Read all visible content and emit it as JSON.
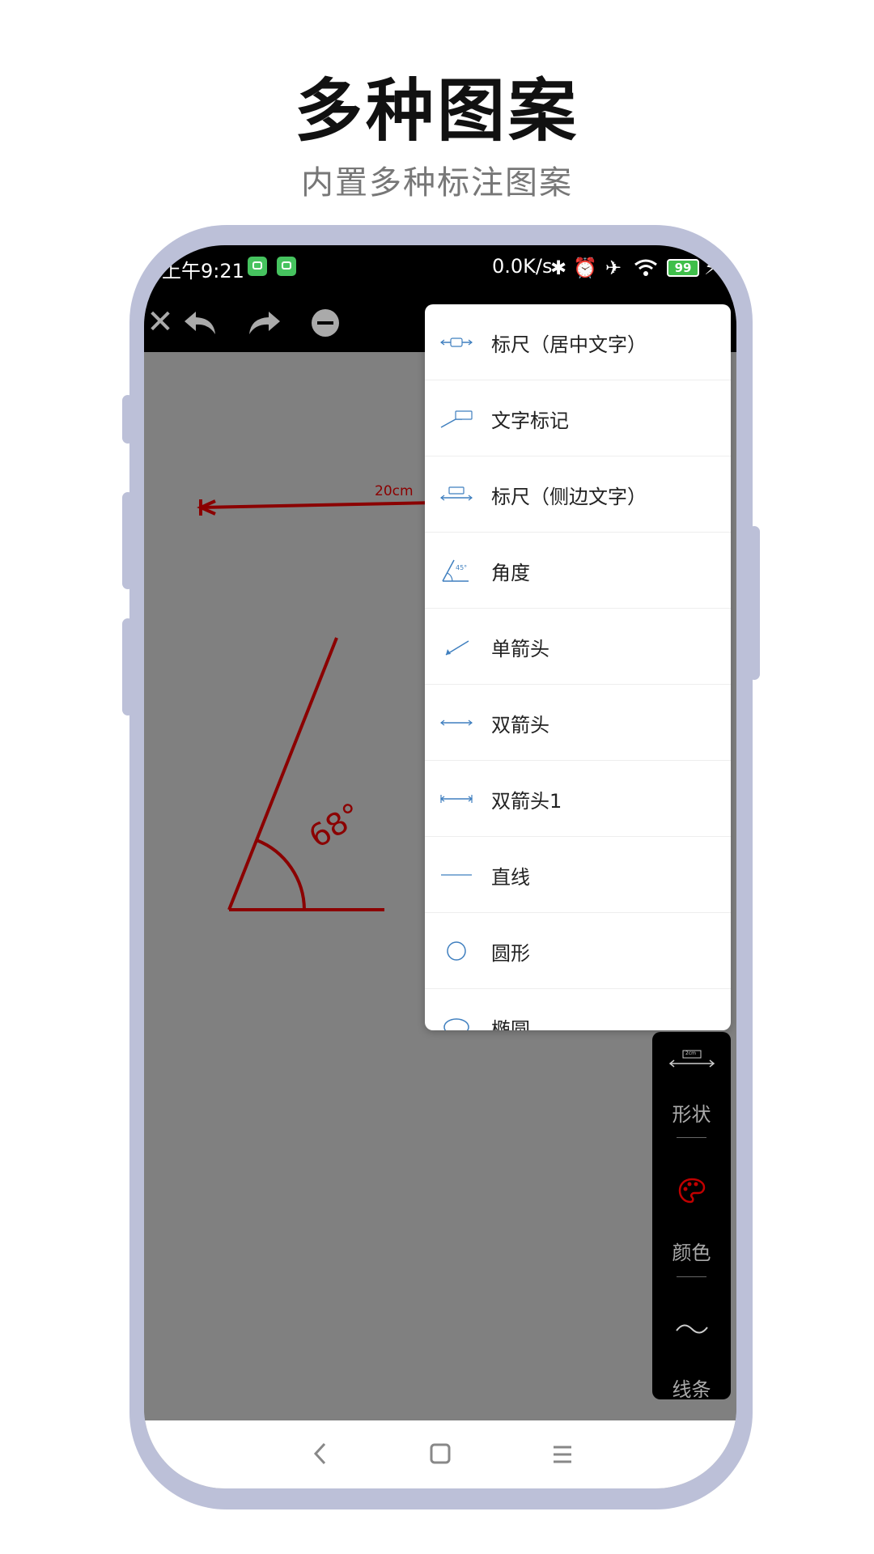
{
  "header": {
    "title": "多种图案",
    "subtitle": "内置多种标注图案"
  },
  "status_bar": {
    "time": "上午9:21",
    "net_speed": "0.0K/s",
    "battery": "99"
  },
  "toolbar": {
    "icons": [
      "close-icon",
      "undo-icon",
      "redo-icon",
      "minus-circle-icon"
    ]
  },
  "canvas": {
    "ruler_label": "20cm",
    "angle_label": "68°",
    "annotation_color": "#8b0000"
  },
  "shape_menu": {
    "items": [
      {
        "label": "标尺（居中文字）",
        "icon": "ruler-center-text-icon"
      },
      {
        "label": "文字标记",
        "icon": "text-marker-icon"
      },
      {
        "label": "标尺（侧边文字）",
        "icon": "ruler-side-text-icon"
      },
      {
        "label": "角度",
        "icon": "angle-icon"
      },
      {
        "label": "单箭头",
        "icon": "single-arrow-icon"
      },
      {
        "label": "双箭头",
        "icon": "double-arrow-icon"
      },
      {
        "label": "双箭头1",
        "icon": "double-arrow-bar-icon"
      },
      {
        "label": "直线",
        "icon": "line-icon"
      },
      {
        "label": "圆形",
        "icon": "circle-icon"
      },
      {
        "label": "椭圆",
        "icon": "ellipse-icon"
      }
    ],
    "accent_color": "#3f7fbf"
  },
  "side_panel": {
    "shape_label": "形状",
    "shape_icon_text": "2cm",
    "color_label": "颜色",
    "line_label": "线条"
  },
  "colors": {
    "frame": "#bcc0d8",
    "canvas": "#808080",
    "accent": "#3f7fbf",
    "annotation": "#8b0000"
  }
}
